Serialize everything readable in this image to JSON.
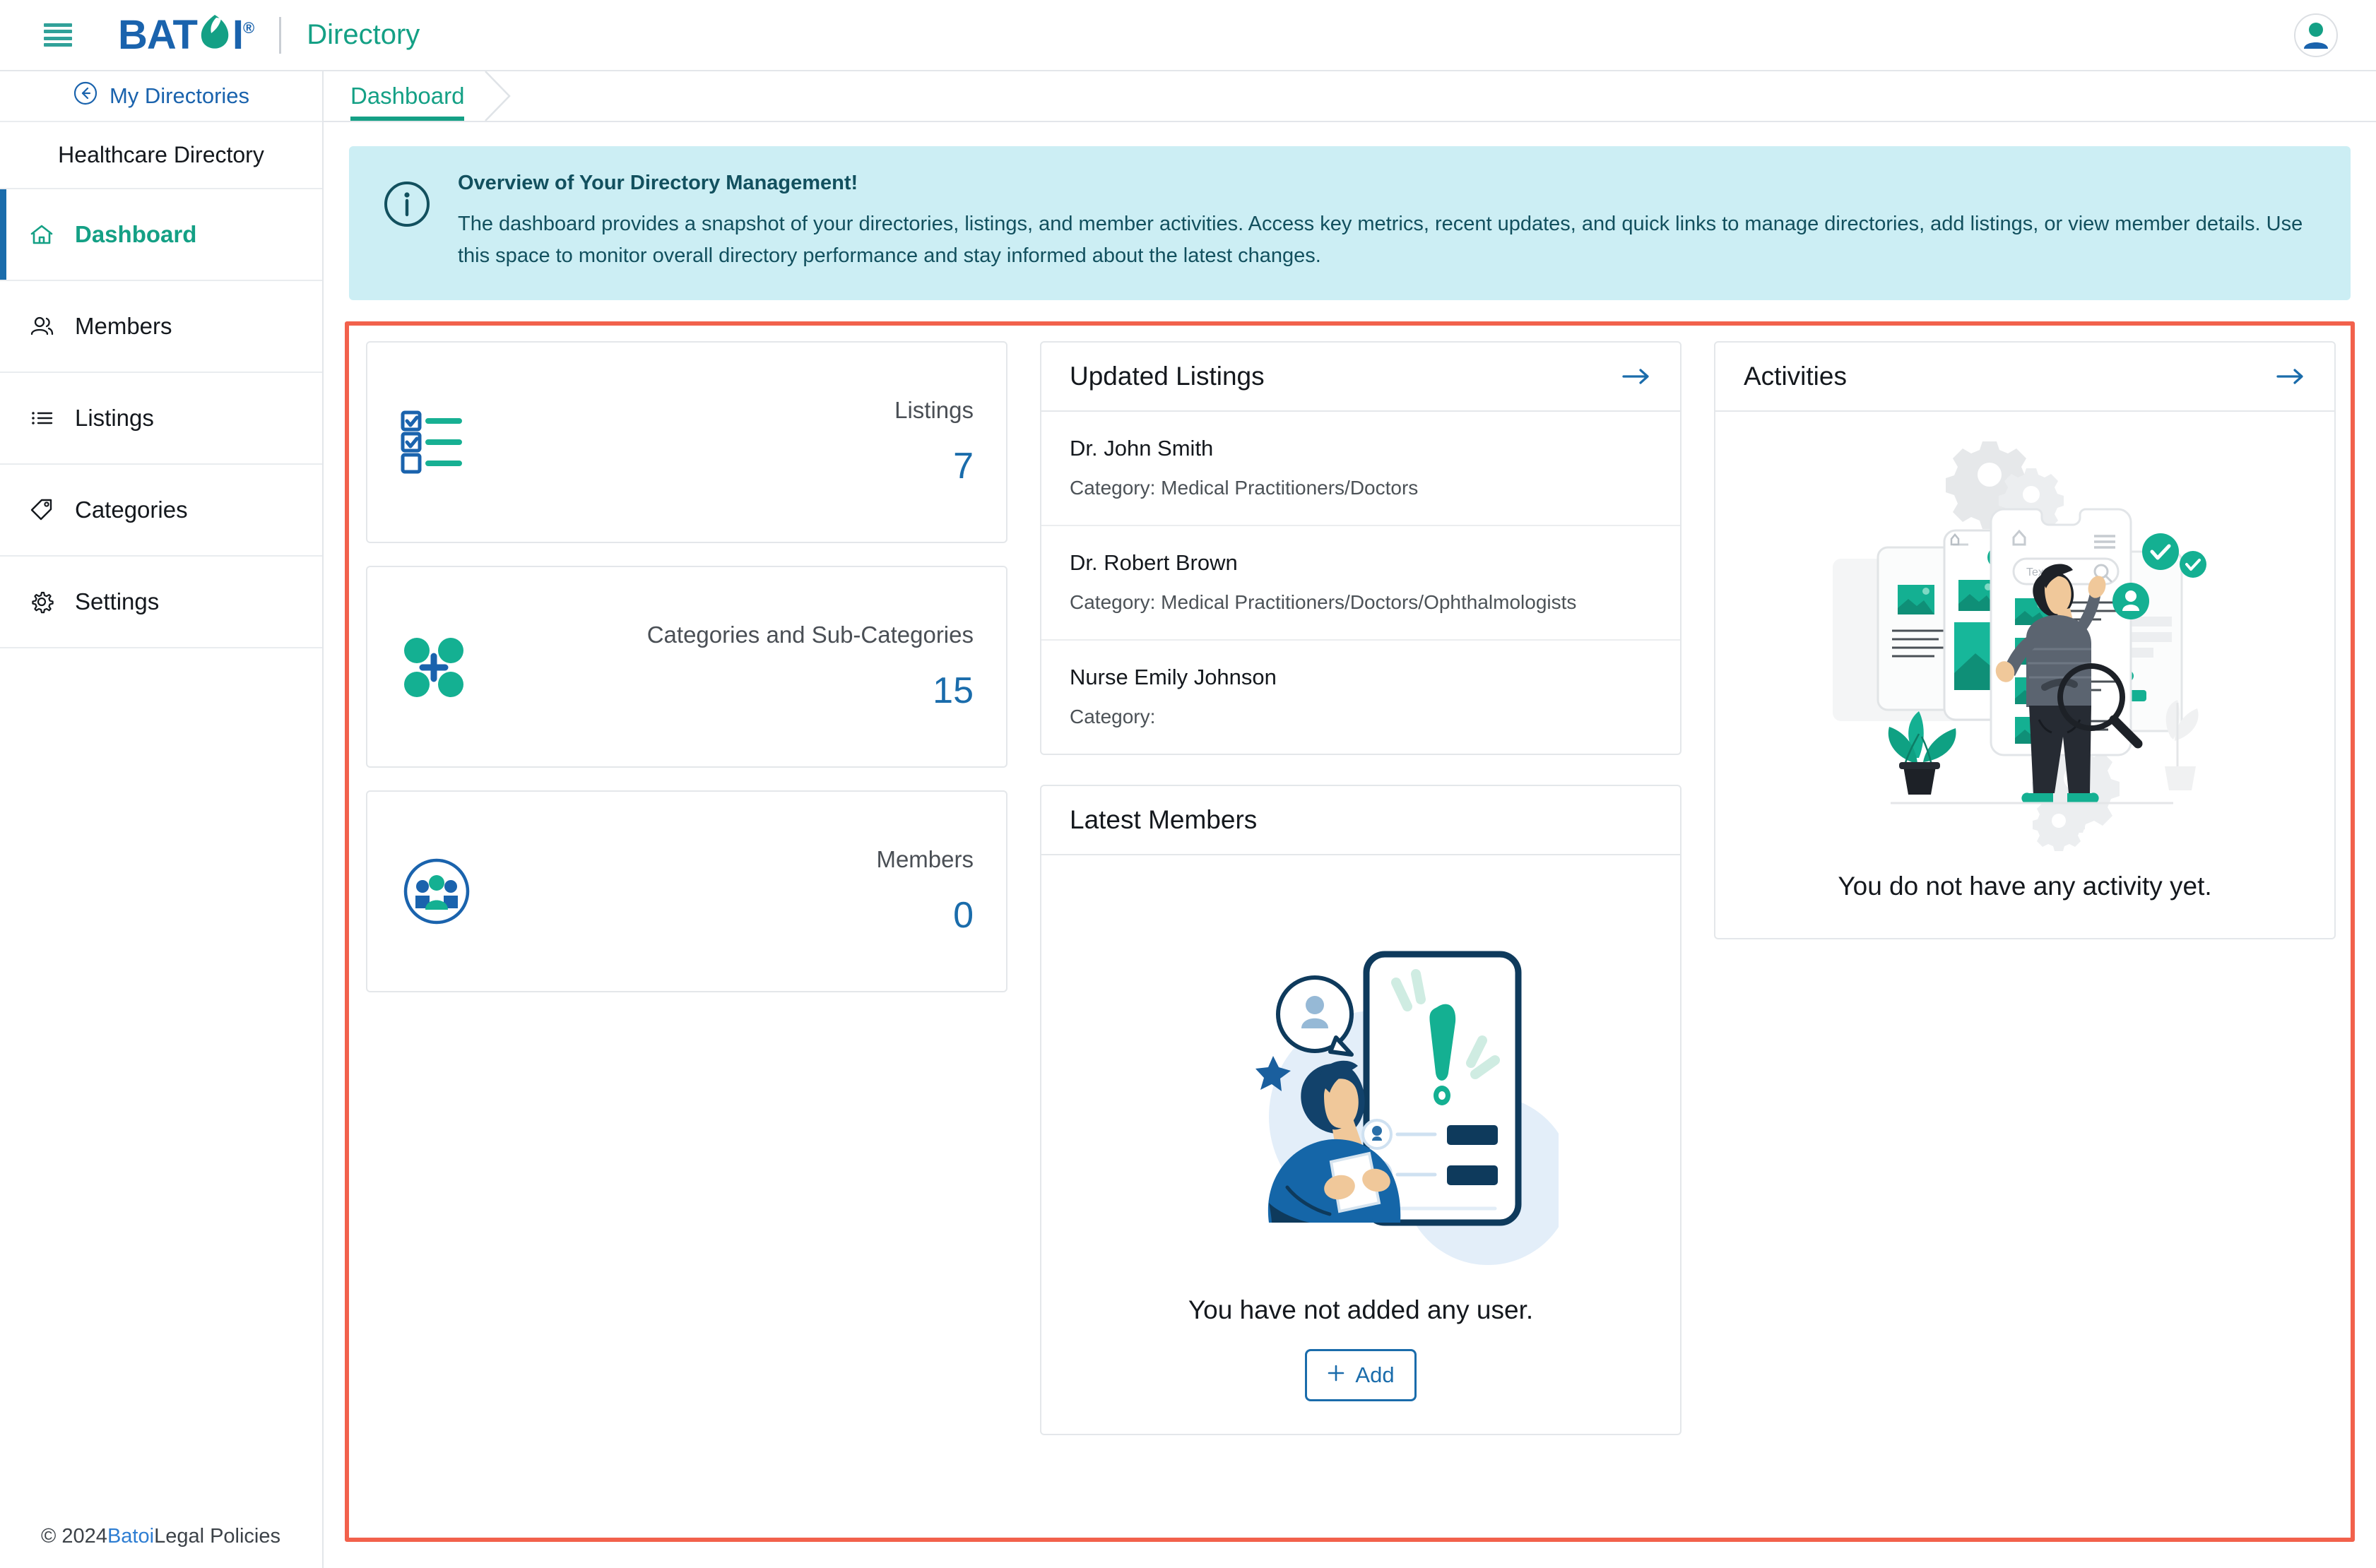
{
  "topbar": {
    "menu_icon": "hamburger-icon",
    "brand": "BAT",
    "brand_suffix": "I",
    "brand_reg": "®",
    "app_name": "Directory",
    "avatar_icon": "user-avatar-icon"
  },
  "sidebar": {
    "back_label": "My Directories",
    "back_icon": "circle-arrow-left-icon",
    "directory_name": "Healthcare Directory",
    "items": [
      {
        "label": "Dashboard",
        "icon": "home-icon",
        "active": true
      },
      {
        "label": "Members",
        "icon": "users-icon",
        "active": false
      },
      {
        "label": "Listings",
        "icon": "list-icon",
        "active": false
      },
      {
        "label": "Categories",
        "icon": "tag-icon",
        "active": false
      },
      {
        "label": "Settings",
        "icon": "gear-icon",
        "active": false
      }
    ]
  },
  "footer": {
    "copyright": "© 2024 ",
    "link": "Batoi",
    "rest": " Legal Policies"
  },
  "breadcrumb": {
    "current": "Dashboard"
  },
  "banner": {
    "icon": "info-circle-icon",
    "title": "Overview of Your Directory Management!",
    "body": "The dashboard provides a snapshot of your directories, listings, and member activities. Access key metrics, recent updates, and quick links to manage directories, add listings, or view member details. Use this space to monitor overall directory performance and stay informed about the latest changes."
  },
  "stats": [
    {
      "label": "Listings",
      "value": "7",
      "icon": "checklist-icon"
    },
    {
      "label": "Categories and Sub-Categories",
      "value": "15",
      "icon": "categories-plus-icon"
    },
    {
      "label": "Members",
      "value": "0",
      "icon": "members-circle-icon"
    }
  ],
  "updated_listings": {
    "title": "Updated Listings",
    "arrow_icon": "arrow-right-icon",
    "rows": [
      {
        "name": "Dr. John Smith",
        "category": "Category: Medical Practitioners/Doctors"
      },
      {
        "name": "Dr. Robert Brown",
        "category": "Category: Medical Practitioners/Doctors/Ophthalmologists"
      },
      {
        "name": "Nurse Emily Johnson",
        "category": "Category:"
      }
    ]
  },
  "latest_members": {
    "title": "Latest Members",
    "illustration": "woman-with-phone-illustration",
    "empty_text": "You have not added any user.",
    "add_label": "Add",
    "add_icon": "plus-icon"
  },
  "activities": {
    "title": "Activities",
    "arrow_icon": "arrow-right-icon",
    "illustration": "man-organizing-content-illustration",
    "empty_text": "You do not have any activity yet."
  },
  "colors": {
    "accent_teal": "#14a085",
    "accent_blue": "#1a6cab",
    "highlight_red": "#f2614c",
    "banner_bg": "#cceef4",
    "banner_text": "#12505e"
  }
}
